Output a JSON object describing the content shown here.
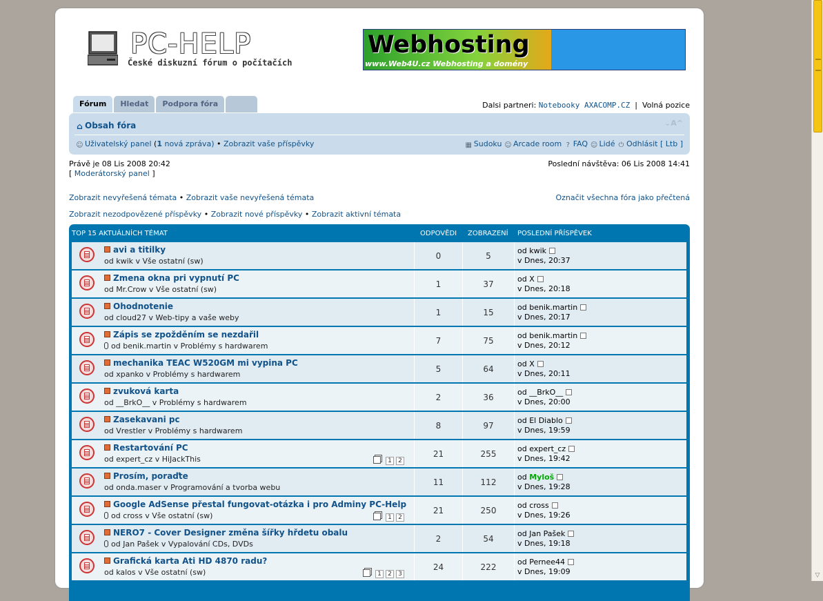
{
  "header": {
    "logo_text": "PC-HELP",
    "logo_subtitle": "České diskuzní fórum o počítačích",
    "banner_title": "Webhosting",
    "banner_subtitle": "www.Web4U.cz  Webhosting a domény"
  },
  "tabs": [
    {
      "label": "Fórum"
    },
    {
      "label": "Hledat"
    },
    {
      "label": "Podpora fóra"
    },
    {
      "label": ""
    }
  ],
  "partners": {
    "prefix": "Dalsi partneri:",
    "link": "Notebooky AXACOMP.CZ",
    "separator": "|",
    "free": "Volná pozice"
  },
  "navbar": {
    "breadcrumb": "Obsah fóra",
    "font_controls": "A",
    "user_panel": "Uživatelský panel",
    "new_messages_prefix": "(",
    "new_messages_count": "1",
    "new_messages_suffix": "nová zpráva)",
    "bullet": "•",
    "view_posts": "Zobrazit vaše příspěvky",
    "sudoku": "Sudoku",
    "arcade": "Arcade room",
    "faq": "FAQ",
    "people": "Lidé",
    "logout": "Odhlásit [ Ltb ]"
  },
  "info": {
    "now": "Právě je 08 Lis 2008 20:42",
    "mod_open": "[",
    "mod_panel": "Moderátorský panel",
    "mod_close": "]",
    "last_visit": "Poslední návštěva: 06 Lis 2008 14:41",
    "unsolved": "Zobrazit nevyřešená témata",
    "bullet": "•",
    "my_unsolved": "Zobrazit vaše nevyřešená témata",
    "mark_read": "Označit všechna fóra jako přečtená",
    "unanswered": "Zobrazit nezodpovězené příspěvky",
    "new_posts": "Zobrazit nové příspěvky",
    "active": "Zobrazit aktivní témata"
  },
  "topics": {
    "header_title": "TOP 15 AKTUÁLNÍCH TÉMAT",
    "col_replies": "ODPOVĚDI",
    "col_views": "ZOBRAZENÍ",
    "col_last": "POSLEDNÍ PŘÍSPĚVEK",
    "rows": [
      {
        "title": "avi a titilky",
        "meta": "od kwik v Vše ostatní (sw)",
        "replies": "0",
        "views": "5",
        "last_by": "od kwik",
        "last_time": "v Dnes, 20:37"
      },
      {
        "title": "Zmena okna pri vypnutí PC",
        "meta": "od Mr.Crow v Vše ostatní (sw)",
        "replies": "1",
        "views": "37",
        "last_by": "od X",
        "last_time": "v Dnes, 20:18"
      },
      {
        "title": "Ohodnotenie",
        "meta": "od cloud27 v Web-tipy a vaše weby",
        "replies": "1",
        "views": "15",
        "last_by": "od benik.martin",
        "last_time": "v Dnes, 20:17"
      },
      {
        "title": "Zápis se zpožděním se nezdařil",
        "meta": "od benik.martin v Problémy s hardwarem",
        "replies": "7",
        "views": "75",
        "last_by": "od benik.martin",
        "last_time": "v Dnes, 20:12"
      },
      {
        "title": "mechanika TEAC W520GM mi vypina PC",
        "meta": "od xpanko v Problémy s hardwarem",
        "replies": "5",
        "views": "64",
        "last_by": "od X",
        "last_time": "v Dnes, 20:11"
      },
      {
        "title": "zvuková karta",
        "meta": "od __BrkO__ v Problémy s hardwarem",
        "replies": "2",
        "views": "36",
        "last_by": "od __BrkO__",
        "last_time": "v Dnes, 20:00"
      },
      {
        "title": "Zasekavani pc",
        "meta": "od Vrestler v Problémy s hardwarem",
        "replies": "8",
        "views": "97",
        "last_by": "od El Diablo",
        "last_time": "v Dnes, 19:59"
      },
      {
        "title": "Restartování PC",
        "meta": "od expert_cz v HiJackThis",
        "replies": "21",
        "views": "255",
        "last_by": "od expert_cz",
        "last_time": "v Dnes, 19:42",
        "pages": [
          "1",
          "2"
        ]
      },
      {
        "title": "Prosím, poraďte",
        "meta": "od onda.maser v Programování a tvorba webu",
        "replies": "11",
        "views": "112",
        "last_prefix": "od",
        "last_user": "Myloš",
        "last_time": "v Dnes, 19:28"
      },
      {
        "title": "Google AdSense přestal fungovat-otázka i pro Adminy PC-Help",
        "meta": "od cross v Vše ostatní (sw)",
        "replies": "21",
        "views": "250",
        "last_by": "od cross",
        "last_time": "v Dnes, 19:26",
        "pages": [
          "1",
          "2"
        ]
      },
      {
        "title": "NERO7 - Cover Designer změna šířky hřdetu obalu",
        "meta": "od Jan Pašek v Vypalování CDs, DVDs",
        "replies": "2",
        "views": "54",
        "last_by": "od Jan Pašek",
        "last_time": "v Dnes, 19:18"
      },
      {
        "title": "Grafická karta Ati HD 4870 radu?",
        "meta": "od kalos v Vše ostatní (sw)",
        "replies": "24",
        "views": "222",
        "last_by": "od Pernee44",
        "last_time": "v Dnes, 19:09",
        "pages": [
          "1",
          "2",
          "3"
        ]
      }
    ]
  }
}
